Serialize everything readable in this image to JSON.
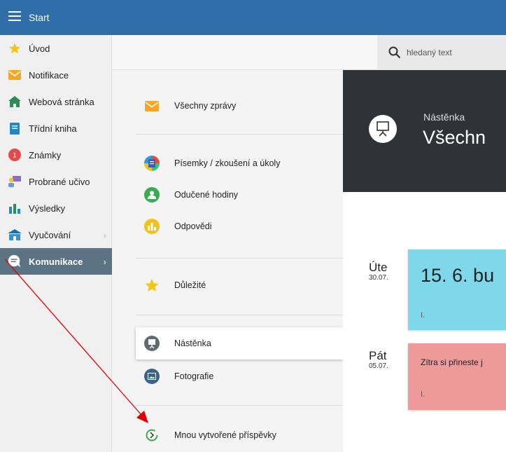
{
  "topbar": {
    "title": "Start"
  },
  "sidebar": {
    "items": [
      {
        "label": "Úvod",
        "icon": "star-icon"
      },
      {
        "label": "Notifikace",
        "icon": "envelope-icon"
      },
      {
        "label": "Webová stránka",
        "icon": "home-icon"
      },
      {
        "label": "Třídní kniha",
        "icon": "book-icon"
      },
      {
        "label": "Známky",
        "icon": "grade-icon"
      },
      {
        "label": "Probrané učivo",
        "icon": "teacher-icon"
      },
      {
        "label": "Výsledky",
        "icon": "bar-chart-icon"
      },
      {
        "label": "Vyučování",
        "icon": "school-icon"
      },
      {
        "label": "Komunikace",
        "icon": "chat-icon"
      }
    ]
  },
  "search": {
    "placeholder": "hledaný text"
  },
  "menu": {
    "items": [
      {
        "label": "Všechny zprávy",
        "icon": "envelope-icon"
      },
      {
        "label": "Písemky / zkoušení a úkoly",
        "icon": "test-icon"
      },
      {
        "label": "Odučené hodiny",
        "icon": "person-icon"
      },
      {
        "label": "Odpovědi",
        "icon": "chart-icon"
      },
      {
        "label": "Důležité",
        "icon": "star-icon"
      },
      {
        "label": "Nástěnka",
        "icon": "board-icon"
      },
      {
        "label": "Fotografie",
        "icon": "photo-icon"
      },
      {
        "label": "Mnou vytvořené příspěvky",
        "icon": "refresh-icon"
      }
    ]
  },
  "hero": {
    "subtitle": "Nástěnka",
    "title": "Všechn"
  },
  "posts": [
    {
      "day": "Úte",
      "date": "30.07.",
      "title": "15. 6. bu",
      "footer": "I.",
      "color": "#7fd7ea"
    },
    {
      "day": "Pát",
      "date": "05.07.",
      "title": "Zítra si přineste j",
      "footer": "I.",
      "color": "#ef9a9a"
    }
  ],
  "colors": {
    "topbar": "#2f6ea8",
    "sidebar_active": "#5b7382",
    "hero": "#2f3338",
    "arrow": "#e00000"
  }
}
